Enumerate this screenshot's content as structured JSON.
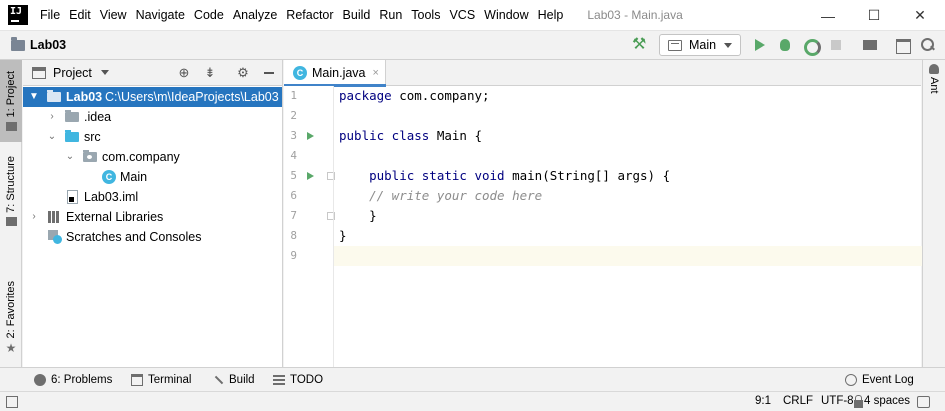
{
  "window": {
    "title": "Lab03 - Main.java",
    "minimize_glyph": "—",
    "maximize_glyph": "☐",
    "close_glyph": "✕"
  },
  "menu": [
    "File",
    "Edit",
    "View",
    "Navigate",
    "Code",
    "Analyze",
    "Refactor",
    "Build",
    "Run",
    "Tools",
    "VCS",
    "Window",
    "Help"
  ],
  "navbar": {
    "project_name": "Lab03",
    "run_config": "Main"
  },
  "left_stripe": {
    "project_tab": "1: Project",
    "structure_tab": "7: Structure",
    "favorites_tab": "2: Favorites"
  },
  "right_stripe": {
    "ant_tab": "Ant"
  },
  "project_panel": {
    "title": "Project",
    "tree": [
      {
        "label": "Lab03",
        "path": "C:\\Users\\m\\IdeaProjects\\Lab03",
        "icon": "module-folder-icon",
        "expanded": true,
        "selected": true
      },
      {
        "label": ".idea",
        "icon": "folder-icon",
        "expanded": false
      },
      {
        "label": "src",
        "icon": "source-folder-icon",
        "expanded": true
      },
      {
        "label": "com.company",
        "icon": "package-icon",
        "expanded": true
      },
      {
        "label": "Main",
        "icon": "class-icon"
      },
      {
        "label": "Lab03.iml",
        "icon": "iml-file-icon"
      },
      {
        "label": "External Libraries",
        "icon": "libraries-icon",
        "expanded": false
      },
      {
        "label": "Scratches and Consoles",
        "icon": "scratches-icon"
      }
    ]
  },
  "editor": {
    "tab_label": "Main.java",
    "tab_close": "×",
    "line_numbers": [
      "1",
      "2",
      "3",
      "4",
      "5",
      "6",
      "7",
      "8",
      "9"
    ],
    "lines": [
      {
        "parts": [
          {
            "t": "package ",
            "c": "kw"
          },
          {
            "t": "com.company;",
            "c": ""
          }
        ]
      },
      {
        "parts": []
      },
      {
        "parts": [
          {
            "t": "public class ",
            "c": "kw"
          },
          {
            "t": "Main {",
            "c": ""
          }
        ]
      },
      {
        "parts": []
      },
      {
        "parts": [
          {
            "t": "    public static void ",
            "c": "kw"
          },
          {
            "t": "main(String[] args) {",
            "c": ""
          }
        ]
      },
      {
        "parts": [
          {
            "t": "    // write your code here",
            "c": "cmt"
          }
        ]
      },
      {
        "parts": [
          {
            "t": "    }",
            "c": ""
          }
        ]
      },
      {
        "parts": [
          {
            "t": "}",
            "c": ""
          }
        ]
      },
      {
        "parts": []
      }
    ]
  },
  "bottom_tools": {
    "problems": "6: Problems",
    "terminal": "Terminal",
    "build": "Build",
    "todo": "TODO",
    "event_log": "Event Log"
  },
  "status": {
    "position": "9:1",
    "line_separator": "CRLF",
    "encoding": "UTF-8",
    "indent": "4 spaces"
  },
  "colors": {
    "selection": "#2675bf",
    "keyword": "#000080",
    "run_green": "#59a869",
    "caret_row": "#fcfaed"
  }
}
